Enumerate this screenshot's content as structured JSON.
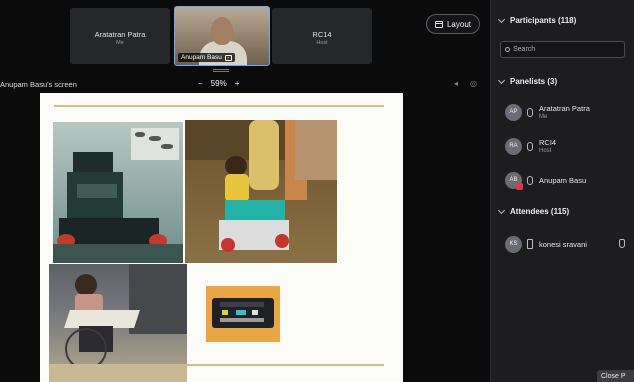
{
  "video_strip": {
    "tiles": [
      {
        "name": "Aratatran Patra",
        "role": "Me"
      },
      {
        "name": "Anupam Basu"
      },
      {
        "name": "RC14",
        "role": "Host"
      }
    ]
  },
  "toolbar": {
    "layout_label": "Layout"
  },
  "share": {
    "title": "Anupam Basu's screen",
    "zoom_minus": "−",
    "zoom": "59%",
    "zoom_plus": "+"
  },
  "participants": {
    "header": "Participants (118)",
    "search_placeholder": "Search",
    "panelists_header": "Panelists (3)",
    "panelists": [
      {
        "initials": "AP",
        "name": "Aratatran Patra",
        "role": "Me"
      },
      {
        "initials": "RA",
        "name": "RCI4",
        "role": "Host"
      },
      {
        "initials": "AB",
        "name": "Anupam Basu",
        "role": ""
      }
    ],
    "attendees_header": "Attendees (115)",
    "attendees": [
      {
        "initials": "KS",
        "name": "konesi sravani"
      }
    ]
  },
  "footer": {
    "close_label": "Close P"
  },
  "colors": {
    "accent": "#6ea8ff",
    "panel_bg": "#1d1d20",
    "rec": "#e0364a"
  },
  "icons": [
    "layout-icon",
    "search-icon",
    "chevron-down-icon",
    "mic-icon",
    "phone-icon",
    "hand-icon",
    "camera-icon"
  ]
}
